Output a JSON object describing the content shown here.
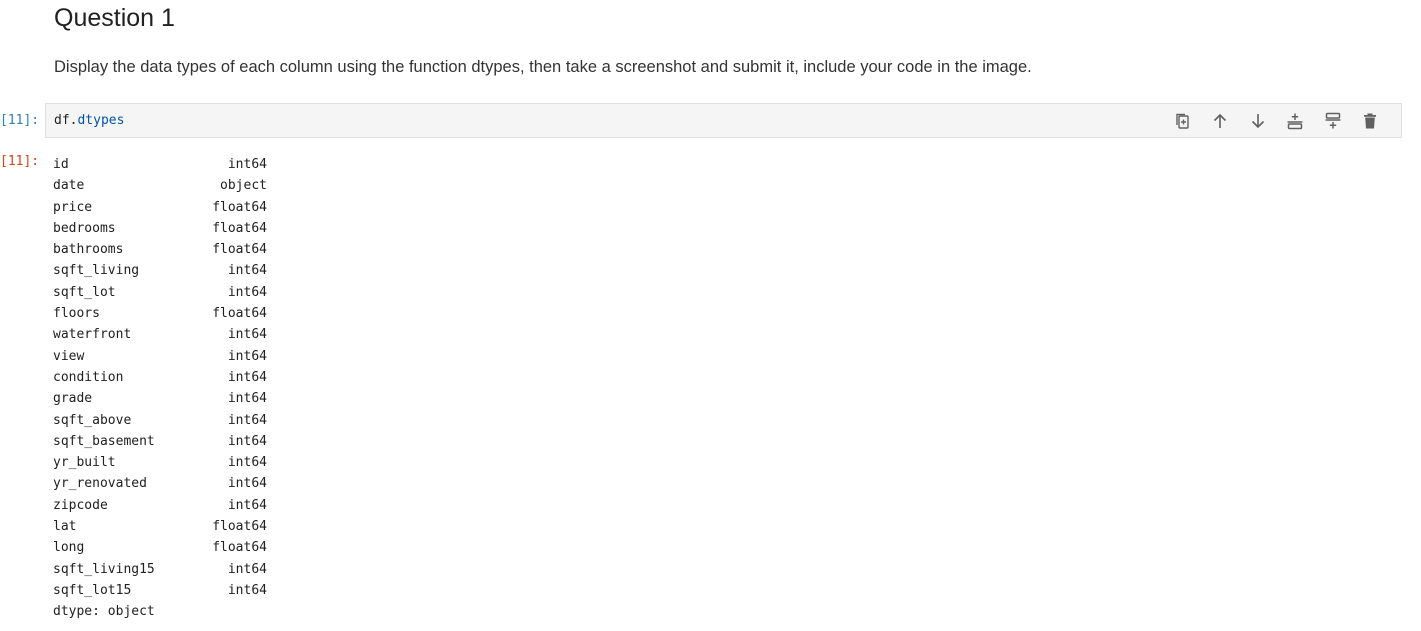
{
  "question": {
    "title": "Question 1",
    "text": "Display the data types of each column using the function dtypes, then take a screenshot and submit it, include your code in the image."
  },
  "cell": {
    "in_prompt": "[11]:",
    "out_prompt": "[11]:",
    "code_obj": "df",
    "code_dot": ".",
    "code_attr": "dtypes"
  },
  "toolbar": {
    "icons": [
      "duplicate-icon",
      "move-up-icon",
      "move-down-icon",
      "insert-above-icon",
      "insert-below-icon",
      "delete-icon"
    ]
  },
  "output": {
    "rows": [
      {
        "name": "id",
        "dtype": "int64"
      },
      {
        "name": "date",
        "dtype": "object"
      },
      {
        "name": "price",
        "dtype": "float64"
      },
      {
        "name": "bedrooms",
        "dtype": "float64"
      },
      {
        "name": "bathrooms",
        "dtype": "float64"
      },
      {
        "name": "sqft_living",
        "dtype": "int64"
      },
      {
        "name": "sqft_lot",
        "dtype": "int64"
      },
      {
        "name": "floors",
        "dtype": "float64"
      },
      {
        "name": "waterfront",
        "dtype": "int64"
      },
      {
        "name": "view",
        "dtype": "int64"
      },
      {
        "name": "condition",
        "dtype": "int64"
      },
      {
        "name": "grade",
        "dtype": "int64"
      },
      {
        "name": "sqft_above",
        "dtype": "int64"
      },
      {
        "name": "sqft_basement",
        "dtype": "int64"
      },
      {
        "name": "yr_built",
        "dtype": "int64"
      },
      {
        "name": "yr_renovated",
        "dtype": "int64"
      },
      {
        "name": "zipcode",
        "dtype": "int64"
      },
      {
        "name": "lat",
        "dtype": "float64"
      },
      {
        "name": "long",
        "dtype": "float64"
      },
      {
        "name": "sqft_living15",
        "dtype": "int64"
      },
      {
        "name": "sqft_lot15",
        "dtype": "int64"
      }
    ],
    "footer": "dtype: object"
  }
}
